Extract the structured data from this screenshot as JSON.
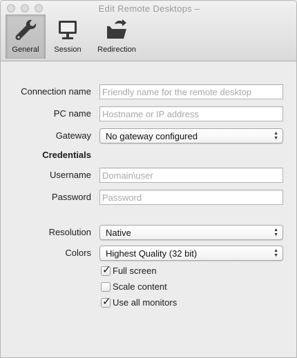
{
  "window": {
    "title": "Edit Remote Desktops –"
  },
  "toolbar": {
    "tabs": [
      {
        "label": "General",
        "icon": "wrench-icon",
        "selected": true
      },
      {
        "label": "Session",
        "icon": "monitor-icon",
        "selected": false
      },
      {
        "label": "Redirection",
        "icon": "folder-redirect-icon",
        "selected": false
      }
    ]
  },
  "form": {
    "connection_name": {
      "label": "Connection name",
      "placeholder": "Friendly name for the remote desktop",
      "value": ""
    },
    "pc_name": {
      "label": "PC name",
      "placeholder": "Hostname or IP address",
      "value": ""
    },
    "gateway": {
      "label": "Gateway",
      "value": "No gateway configured"
    },
    "credentials_heading": "Credentials",
    "username": {
      "label": "Username",
      "placeholder": "Domain\\user",
      "value": ""
    },
    "password": {
      "label": "Password",
      "placeholder": "Password",
      "value": ""
    },
    "resolution": {
      "label": "Resolution",
      "value": "Native"
    },
    "colors": {
      "label": "Colors",
      "value": "Highest Quality (32 bit)"
    },
    "checkboxes": [
      {
        "label": "Full screen",
        "checked": true
      },
      {
        "label": "Scale content",
        "checked": false
      },
      {
        "label": "Use all monitors",
        "checked": true
      }
    ]
  }
}
